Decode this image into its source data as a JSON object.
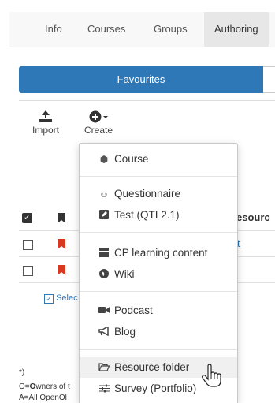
{
  "nav": {
    "items": [
      {
        "label": "Info"
      },
      {
        "label": "Courses"
      },
      {
        "label": "Groups"
      },
      {
        "label": "Authoring"
      }
    ]
  },
  "segment": {
    "active_label": "Favourites"
  },
  "toolbar": {
    "import_label": "Import",
    "create_label": "Create"
  },
  "table": {
    "header_partial": "esourc",
    "row1_partial": "t",
    "select_partial": "Selec"
  },
  "footnote": {
    "star": "*)",
    "owners_pre": "O=",
    "owners_bold": "O",
    "owners_post": "wners of t",
    "all": "A=All OpenOl"
  },
  "menu": {
    "items": [
      {
        "label": "Course",
        "icon": "cube-icon"
      },
      {
        "label": "Questionnaire",
        "icon": "smiley-icon"
      },
      {
        "label": "Test (QTI 2.1)",
        "icon": "edit-icon"
      },
      {
        "label": "CP learning content",
        "icon": "book-icon"
      },
      {
        "label": "Wiki",
        "icon": "globe-icon"
      },
      {
        "label": "Podcast",
        "icon": "video-icon"
      },
      {
        "label": "Blog",
        "icon": "bullhorn-icon"
      },
      {
        "label": "Resource folder",
        "icon": "folder-open-icon"
      },
      {
        "label": "Survey (Portfolio)",
        "icon": "sliders-icon"
      }
    ]
  },
  "colors": {
    "primary": "#2f78b8",
    "bookmark": "#d9381e"
  }
}
